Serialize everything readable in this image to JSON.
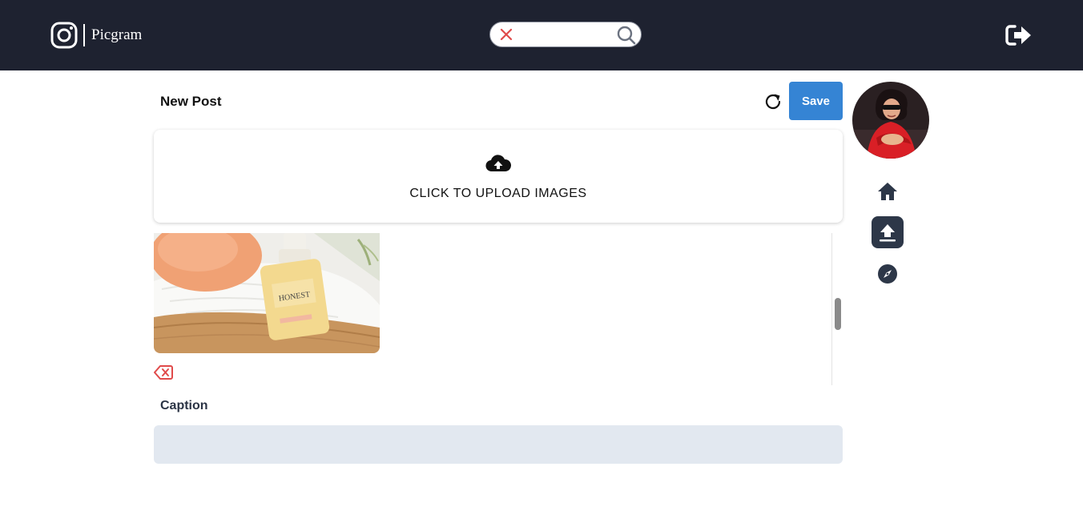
{
  "header": {
    "brand": "Picgram",
    "search": {
      "value": "",
      "placeholder": ""
    }
  },
  "icons": {
    "logo": "instagram-logo-icon",
    "search_clear": "close-icon",
    "search": "search-icon",
    "logout": "logout-icon",
    "refresh": "refresh-icon",
    "upload": "cloud-upload-icon",
    "remove_image": "backspace-icon",
    "nav_home": "home-icon",
    "nav_upload": "upload-icon",
    "nav_explore": "compass-icon"
  },
  "post": {
    "title": "New Post",
    "save_label": "Save",
    "upload_label": "CLICK TO UPLOAD IMAGES",
    "caption_label": "Caption",
    "caption_value": ""
  },
  "colors": {
    "header_bg": "#1e2230",
    "save_button": "#3584d4",
    "remove_icon": "#e04a4a",
    "caption_bg": "#e2e8f0",
    "nav_active_bg": "#2d3748"
  }
}
